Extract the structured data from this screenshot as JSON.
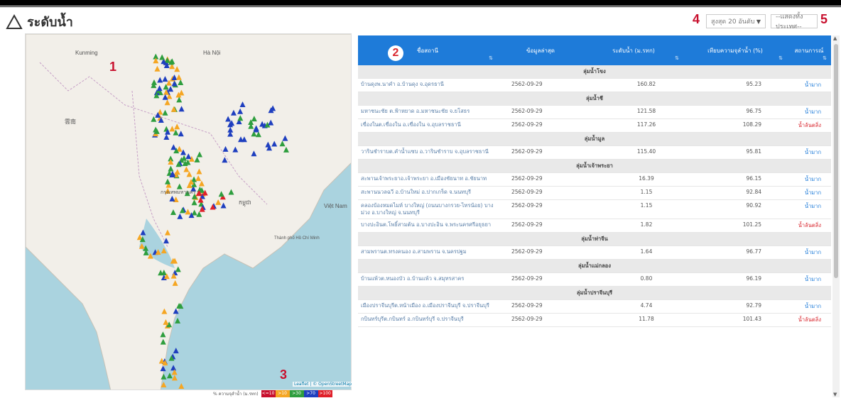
{
  "header": {
    "title": "ระดับน้ำ",
    "badge_sort": "4",
    "badge_basin": "5",
    "sort_select": "สูงสุด 20 อันดับ",
    "basin_select": "--แสดงทั้งประเทศ--"
  },
  "map": {
    "badge": "1",
    "labels": {
      "kunming": "Kunming",
      "yunnan": "雲南",
      "hanoi": "Hà Nội",
      "bangkok": "กรุงเทพมหานคร",
      "khmer": "កម្ពុជា",
      "vietnam": "Việt Nam",
      "hochiminh": "Thành phố Hồ Chí Minh"
    },
    "badge_legend": "3",
    "attribution": "Leaflet | © OpenStreetMap",
    "legend_label": "% ความจุลำน้ำ (ม.รทก)",
    "legend_items": [
      {
        "label": "<=10",
        "color": "#c8102e"
      },
      {
        "label": ">10",
        "color": "#f5a623"
      },
      {
        "label": ">30",
        "color": "#2e9e3e"
      },
      {
        "label": ">70",
        "color": "#1f3fbf"
      },
      {
        "label": ">100",
        "color": "#e0202a"
      }
    ]
  },
  "table": {
    "badge": "2",
    "columns": [
      "ชื่อสถานี",
      "ข้อมูลล่าสุด",
      "ระดับน้ำ (ม.รทก)",
      "เทียบความจุลำน้ำ (%)",
      "สถานการณ์"
    ],
    "rows": [
      {
        "group": "ลุ่มน้ำโขง"
      },
      {
        "station": "บ้านดุงพ.นาคำ อ.บ้านดุง จ.อุดรธานี",
        "date": "2562-09-29",
        "level": "160.82",
        "capacity": "95.23",
        "status": "น้ำมาก",
        "high": false
      },
      {
        "group": "ลุ่มน้ำชี"
      },
      {
        "station": "มหาชนะชัย ต.ฟ้าหยาด อ.มหาชนะชัย จ.ยโสธร",
        "date": "2562-09-29",
        "level": "121.58",
        "capacity": "96.75",
        "status": "น้ำมาก",
        "high": false
      },
      {
        "station": "เขื่องในต.เขื่องใน อ.เขื่องใน จ.อุบลราชธานี",
        "date": "2562-09-29",
        "level": "117.26",
        "capacity": "108.29",
        "status": "น้ำล้นตลิ่ง",
        "high": true
      },
      {
        "group": "ลุ่มน้ำมูล"
      },
      {
        "station": "วารินชำราบต.คำน้ำแซบ อ.วารินชำราบ จ.อุบลราชธานี",
        "date": "2562-09-29",
        "level": "115.40",
        "capacity": "95.81",
        "status": "น้ำมาก",
        "high": false
      },
      {
        "group": "ลุ่มน้ำเจ้าพระยา"
      },
      {
        "station": "สะพานเจ้าพระยาอ.เจ้าพระยา อ.เมืองชัยนาท อ.ชัยนาท",
        "date": "2562-09-29",
        "level": "16.39",
        "capacity": "96.15",
        "status": "น้ำมาก",
        "high": false
      },
      {
        "station": "สะพานนวลฉวี อ.บ้านใหม่ อ.ปากเกร็ด จ.นนทบุรี",
        "date": "2562-09-29",
        "level": "1.15",
        "capacity": "92.84",
        "status": "น้ำมาก",
        "high": false
      },
      {
        "station": "คลองบ้องหมดไมห์ บางใหญ่ (ถนนบางกรวย-ไทรน้อย) บางม่วง อ.บางใหญ่ จ.นนทบุรี",
        "date": "2562-09-29",
        "level": "1.15",
        "capacity": "90.92",
        "status": "น้ำมาก",
        "high": false
      },
      {
        "station": "บางปะอินต.โพธิ์สามต้น อ.บางปะอิน จ.พระนครศรีอยุธยา",
        "date": "2562-09-29",
        "level": "1.82",
        "capacity": "101.25",
        "status": "น้ำล้นตลิ่ง",
        "high": true
      },
      {
        "group": "ลุ่มน้ำท่าจีน"
      },
      {
        "station": "สามพรานต.ทรงคนอง อ.สามพราน จ.นครปฐม",
        "date": "2562-09-29",
        "level": "1.64",
        "capacity": "96.77",
        "status": "น้ำมาก",
        "high": false
      },
      {
        "group": "ลุ่มน้ำแม่กลอง"
      },
      {
        "station": "บ้านแพ้วต.หนองบัว อ.บ้านแพ้ว จ.สมุทรสาคร",
        "date": "2562-09-29",
        "level": "0.80",
        "capacity": "96.19",
        "status": "น้ำมาก",
        "high": false
      },
      {
        "group": "ลุ่มน้ำปราจีนบุรี"
      },
      {
        "station": "เมืองปราจีนบุรีต.หน้าเมือง อ.เมืองปราจีนบุรี จ.ปราจีนบุรี",
        "date": "2562-09-29",
        "level": "4.74",
        "capacity": "92.79",
        "status": "น้ำมาก",
        "high": false
      },
      {
        "station": "กบินทร์บุรีต.กบินทร์ อ.กบินทร์บุรี จ.ปราจีนบุรี",
        "date": "2562-09-29",
        "level": "11.78",
        "capacity": "101.43",
        "status": "น้ำล้นตลิ่ง",
        "high": true
      }
    ]
  }
}
